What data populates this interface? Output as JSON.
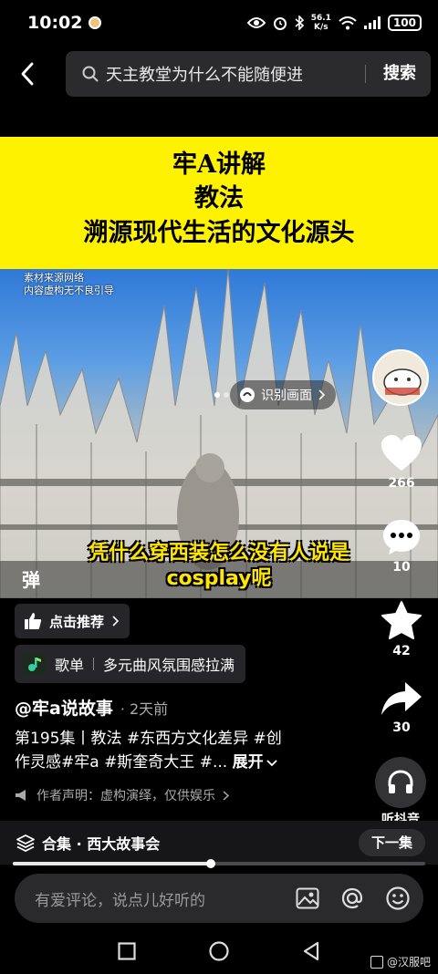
{
  "status_bar": {
    "time": "10:02",
    "net_speed_value": "56.1",
    "net_speed_unit": "K/s",
    "battery": "100"
  },
  "search": {
    "query": "天主教堂为什么不能随便进",
    "submit_label": "搜索"
  },
  "video": {
    "banner_line1": "牢A讲解",
    "banner_line2": "教法",
    "banner_line3": "溯源现代生活的文化源头",
    "source_note_line1": "素材来源网络",
    "source_note_line2": "内容虚构无不良引导",
    "identify_label": "识别画面",
    "subtitle_line1": "凭什么穿西装怎么没有人说是",
    "subtitle_line2": "cosplay呢",
    "danmu_label": "弹"
  },
  "actions": {
    "likes": "266",
    "comments": "10",
    "favorites": "42",
    "shares": "30",
    "listen_label": "听抖音"
  },
  "info": {
    "recommend_label": "点击推荐",
    "playlist_title": "歌单",
    "playlist_name": "多元曲风氛围感拉满",
    "author": "@牢a说故事",
    "time_ago": "2天前",
    "description_line1": "第195集丨教法 #东西方文化差异 #创",
    "description_line2": "作灵感#牢a #斯奎奇大王 #...",
    "expand_label": "展开",
    "disclaimer": "作者声明：虚构演绎，仅供娱乐"
  },
  "collection": {
    "label": "合集 · 西大故事会",
    "next_label": "下一集",
    "progress": 0.48
  },
  "comment": {
    "placeholder": "有爱评论，说点儿好听的"
  },
  "watermark": "@汉服吧",
  "colors": {
    "banner_yellow": "#fff200",
    "subtitle_yellow": "#ffe600",
    "background": "#000000"
  }
}
